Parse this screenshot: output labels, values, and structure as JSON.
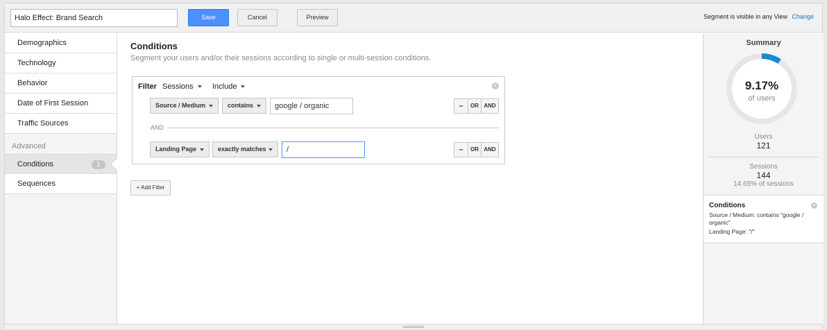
{
  "header": {
    "segment_name": "Halo Effect: Brand Search",
    "save_label": "Save",
    "cancel_label": "Cancel",
    "preview_label": "Preview",
    "visibility_text": "Segment is visible in any View",
    "change_label": "Change"
  },
  "sidebar": {
    "items": [
      {
        "label": "Demographics"
      },
      {
        "label": "Technology"
      },
      {
        "label": "Behavior"
      },
      {
        "label": "Date of First Session"
      },
      {
        "label": "Traffic Sources"
      }
    ],
    "advanced_label": "Advanced",
    "advanced_items": [
      {
        "label": "Conditions",
        "count": "1"
      },
      {
        "label": "Sequences"
      }
    ]
  },
  "conditions": {
    "title": "Conditions",
    "subtitle": "Segment your users and/or their sessions according to single or multi-session conditions.",
    "filter": {
      "label": "Filter",
      "scope": "Sessions",
      "mode": "Include",
      "rows": [
        {
          "dimension": "Source / Medium",
          "operator": "contains",
          "value": "google / organic"
        },
        {
          "dimension": "Landing Page",
          "operator": "exactly matches",
          "value": "/"
        }
      ],
      "separator": "AND",
      "minus_label": "–",
      "or_label": "OR",
      "and_label": "AND"
    },
    "add_filter_label": "+ Add Filter"
  },
  "summary": {
    "title": "Summary",
    "percent": "9.17%",
    "percent_value": 0.0917,
    "percent_sub": "of users",
    "users_label": "Users",
    "users_value": "121",
    "sessions_label": "Sessions",
    "sessions_value": "144",
    "sessions_pct": "14.65% of sessions",
    "conditions_title": "Conditions",
    "condition_lines": [
      "Source / Medium: contains \"google / organic\"",
      "Landing Page: \"/\""
    ],
    "accent_color": "#1a8ad4",
    "track_color": "#e6e6e6"
  }
}
